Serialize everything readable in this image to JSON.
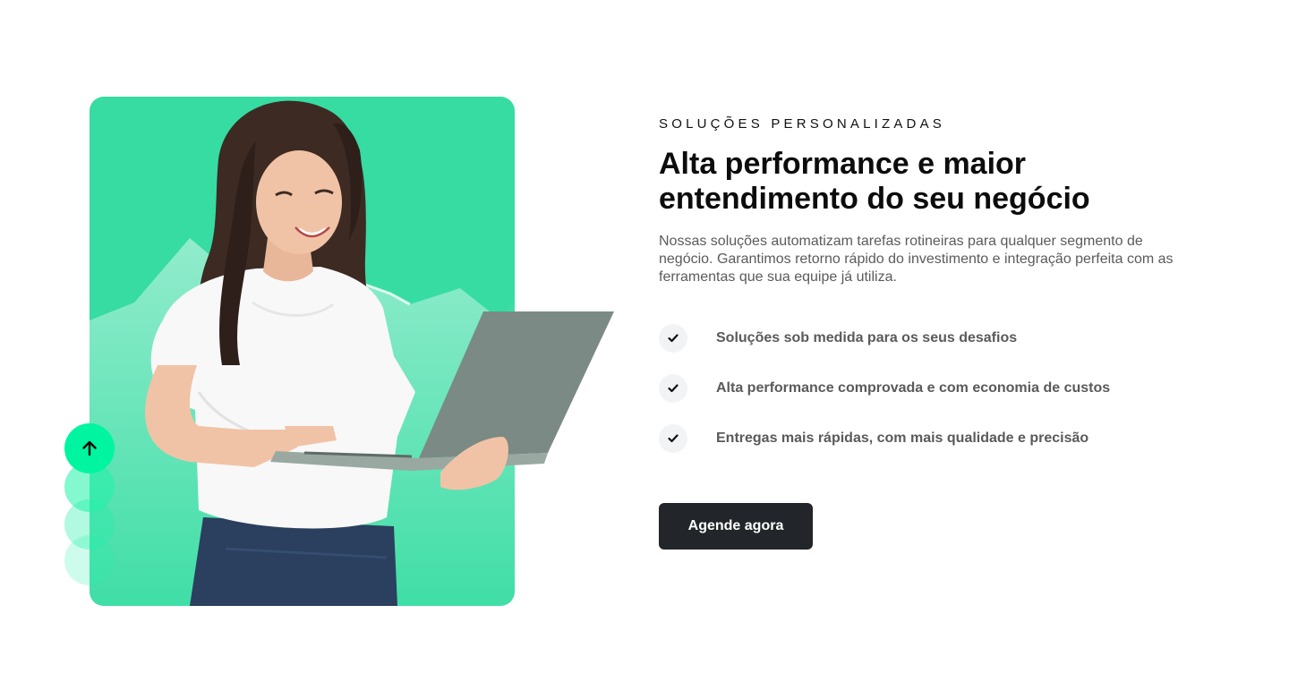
{
  "hero": {
    "photo_subject": "woman-with-laptop",
    "accent_color": "#36dca2",
    "bubble_color": "#00f5a0",
    "scroll_button_icon": "arrow-up-icon"
  },
  "section": {
    "eyebrow": "SOLUÇÕES PERSONALIZADAS",
    "headline": "Alta performance e maior entendimento do seu negócio",
    "description": "Nossas soluções automatizam tarefas rotineiras para qualquer segmento de negócio. Garantimos retorno rápido do investimento e integração perfeita com as ferramentas que sua equipe já utiliza."
  },
  "features": [
    {
      "icon": "check-icon",
      "label": "Soluções sob medida para os seus desafios"
    },
    {
      "icon": "check-icon",
      "label": "Alta performance comprovada e com economia de custos"
    },
    {
      "icon": "check-icon",
      "label": "Entregas mais rápidas, com mais qualidade e precisão"
    }
  ],
  "cta": {
    "label": "Agende agora",
    "background": "#22262a"
  }
}
